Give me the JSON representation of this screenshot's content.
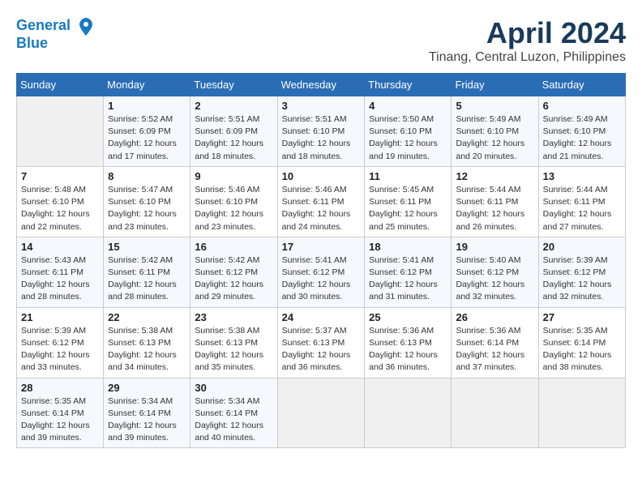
{
  "header": {
    "logo_line1": "General",
    "logo_line2": "Blue",
    "month": "April 2024",
    "location": "Tinang, Central Luzon, Philippines"
  },
  "weekdays": [
    "Sunday",
    "Monday",
    "Tuesday",
    "Wednesday",
    "Thursday",
    "Friday",
    "Saturday"
  ],
  "weeks": [
    [
      {
        "day": "",
        "sunrise": "",
        "sunset": "",
        "daylight": ""
      },
      {
        "day": "1",
        "sunrise": "Sunrise: 5:52 AM",
        "sunset": "Sunset: 6:09 PM",
        "daylight": "Daylight: 12 hours and 17 minutes."
      },
      {
        "day": "2",
        "sunrise": "Sunrise: 5:51 AM",
        "sunset": "Sunset: 6:09 PM",
        "daylight": "Daylight: 12 hours and 18 minutes."
      },
      {
        "day": "3",
        "sunrise": "Sunrise: 5:51 AM",
        "sunset": "Sunset: 6:10 PM",
        "daylight": "Daylight: 12 hours and 18 minutes."
      },
      {
        "day": "4",
        "sunrise": "Sunrise: 5:50 AM",
        "sunset": "Sunset: 6:10 PM",
        "daylight": "Daylight: 12 hours and 19 minutes."
      },
      {
        "day": "5",
        "sunrise": "Sunrise: 5:49 AM",
        "sunset": "Sunset: 6:10 PM",
        "daylight": "Daylight: 12 hours and 20 minutes."
      },
      {
        "day": "6",
        "sunrise": "Sunrise: 5:49 AM",
        "sunset": "Sunset: 6:10 PM",
        "daylight": "Daylight: 12 hours and 21 minutes."
      }
    ],
    [
      {
        "day": "7",
        "sunrise": "Sunrise: 5:48 AM",
        "sunset": "Sunset: 6:10 PM",
        "daylight": "Daylight: 12 hours and 22 minutes."
      },
      {
        "day": "8",
        "sunrise": "Sunrise: 5:47 AM",
        "sunset": "Sunset: 6:10 PM",
        "daylight": "Daylight: 12 hours and 23 minutes."
      },
      {
        "day": "9",
        "sunrise": "Sunrise: 5:46 AM",
        "sunset": "Sunset: 6:10 PM",
        "daylight": "Daylight: 12 hours and 23 minutes."
      },
      {
        "day": "10",
        "sunrise": "Sunrise: 5:46 AM",
        "sunset": "Sunset: 6:11 PM",
        "daylight": "Daylight: 12 hours and 24 minutes."
      },
      {
        "day": "11",
        "sunrise": "Sunrise: 5:45 AM",
        "sunset": "Sunset: 6:11 PM",
        "daylight": "Daylight: 12 hours and 25 minutes."
      },
      {
        "day": "12",
        "sunrise": "Sunrise: 5:44 AM",
        "sunset": "Sunset: 6:11 PM",
        "daylight": "Daylight: 12 hours and 26 minutes."
      },
      {
        "day": "13",
        "sunrise": "Sunrise: 5:44 AM",
        "sunset": "Sunset: 6:11 PM",
        "daylight": "Daylight: 12 hours and 27 minutes."
      }
    ],
    [
      {
        "day": "14",
        "sunrise": "Sunrise: 5:43 AM",
        "sunset": "Sunset: 6:11 PM",
        "daylight": "Daylight: 12 hours and 28 minutes."
      },
      {
        "day": "15",
        "sunrise": "Sunrise: 5:42 AM",
        "sunset": "Sunset: 6:11 PM",
        "daylight": "Daylight: 12 hours and 28 minutes."
      },
      {
        "day": "16",
        "sunrise": "Sunrise: 5:42 AM",
        "sunset": "Sunset: 6:12 PM",
        "daylight": "Daylight: 12 hours and 29 minutes."
      },
      {
        "day": "17",
        "sunrise": "Sunrise: 5:41 AM",
        "sunset": "Sunset: 6:12 PM",
        "daylight": "Daylight: 12 hours and 30 minutes."
      },
      {
        "day": "18",
        "sunrise": "Sunrise: 5:41 AM",
        "sunset": "Sunset: 6:12 PM",
        "daylight": "Daylight: 12 hours and 31 minutes."
      },
      {
        "day": "19",
        "sunrise": "Sunrise: 5:40 AM",
        "sunset": "Sunset: 6:12 PM",
        "daylight": "Daylight: 12 hours and 32 minutes."
      },
      {
        "day": "20",
        "sunrise": "Sunrise: 5:39 AM",
        "sunset": "Sunset: 6:12 PM",
        "daylight": "Daylight: 12 hours and 32 minutes."
      }
    ],
    [
      {
        "day": "21",
        "sunrise": "Sunrise: 5:39 AM",
        "sunset": "Sunset: 6:12 PM",
        "daylight": "Daylight: 12 hours and 33 minutes."
      },
      {
        "day": "22",
        "sunrise": "Sunrise: 5:38 AM",
        "sunset": "Sunset: 6:13 PM",
        "daylight": "Daylight: 12 hours and 34 minutes."
      },
      {
        "day": "23",
        "sunrise": "Sunrise: 5:38 AM",
        "sunset": "Sunset: 6:13 PM",
        "daylight": "Daylight: 12 hours and 35 minutes."
      },
      {
        "day": "24",
        "sunrise": "Sunrise: 5:37 AM",
        "sunset": "Sunset: 6:13 PM",
        "daylight": "Daylight: 12 hours and 36 minutes."
      },
      {
        "day": "25",
        "sunrise": "Sunrise: 5:36 AM",
        "sunset": "Sunset: 6:13 PM",
        "daylight": "Daylight: 12 hours and 36 minutes."
      },
      {
        "day": "26",
        "sunrise": "Sunrise: 5:36 AM",
        "sunset": "Sunset: 6:14 PM",
        "daylight": "Daylight: 12 hours and 37 minutes."
      },
      {
        "day": "27",
        "sunrise": "Sunrise: 5:35 AM",
        "sunset": "Sunset: 6:14 PM",
        "daylight": "Daylight: 12 hours and 38 minutes."
      }
    ],
    [
      {
        "day": "28",
        "sunrise": "Sunrise: 5:35 AM",
        "sunset": "Sunset: 6:14 PM",
        "daylight": "Daylight: 12 hours and 39 minutes."
      },
      {
        "day": "29",
        "sunrise": "Sunrise: 5:34 AM",
        "sunset": "Sunset: 6:14 PM",
        "daylight": "Daylight: 12 hours and 39 minutes."
      },
      {
        "day": "30",
        "sunrise": "Sunrise: 5:34 AM",
        "sunset": "Sunset: 6:14 PM",
        "daylight": "Daylight: 12 hours and 40 minutes."
      },
      {
        "day": "",
        "sunrise": "",
        "sunset": "",
        "daylight": ""
      },
      {
        "day": "",
        "sunrise": "",
        "sunset": "",
        "daylight": ""
      },
      {
        "day": "",
        "sunrise": "",
        "sunset": "",
        "daylight": ""
      },
      {
        "day": "",
        "sunrise": "",
        "sunset": "",
        "daylight": ""
      }
    ]
  ]
}
